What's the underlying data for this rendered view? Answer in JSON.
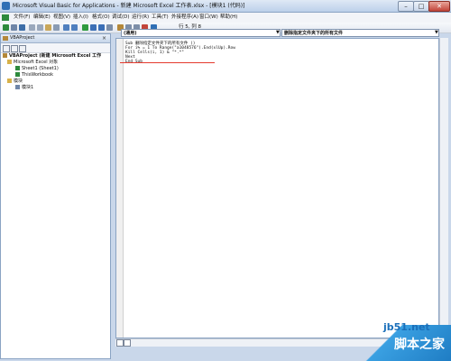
{
  "window": {
    "title": "Microsoft Visual Basic for Applications - 新建 Microsoft Excel 工作表.xlsx - [模块1 (代码)]",
    "min_label": "–",
    "max_label": "□",
    "close_label": "✕"
  },
  "menubar": {
    "items": [
      {
        "label": "文件(F)"
      },
      {
        "label": "编辑(E)"
      },
      {
        "label": "视图(V)"
      },
      {
        "label": "插入(I)"
      },
      {
        "label": "格式(O)"
      },
      {
        "label": "调试(D)"
      },
      {
        "label": "运行(R)"
      },
      {
        "label": "工具(T)"
      },
      {
        "label": "外接程序(A)"
      },
      {
        "label": "窗口(W)"
      },
      {
        "label": "帮助(H)"
      }
    ]
  },
  "toolbar": {
    "position": "行 5, 列 8"
  },
  "project": {
    "title": "VBAProject",
    "close": "×",
    "tree": [
      {
        "label": "VBAProject (新建 Microsoft Excel 工作",
        "bold": true
      },
      {
        "label": "Microsoft Excel 对象"
      },
      {
        "label": "Sheet1 (Sheet1)"
      },
      {
        "label": "ThisWorkbook"
      },
      {
        "label": "模块"
      },
      {
        "label": "模块1"
      }
    ]
  },
  "code": {
    "object_dropdown": "(通用)",
    "procedure_dropdown": "删除指定文件夹下的所有文件",
    "dropdown_arrow": "▼",
    "lines": [
      "Sub 删除指定文件夹下的所有文件 ()",
      "For i% = 1 To Range(\"a1048576\").End(xlUp).Row",
      "Kill Cells(i, 1) & \"*.*\"",
      "Next",
      "End Sub"
    ]
  },
  "watermark": {
    "site": "jb51.net",
    "logo": "脚本之家"
  },
  "colors": {
    "accent": "#2f6fb5",
    "underline": "#e53a2e"
  }
}
